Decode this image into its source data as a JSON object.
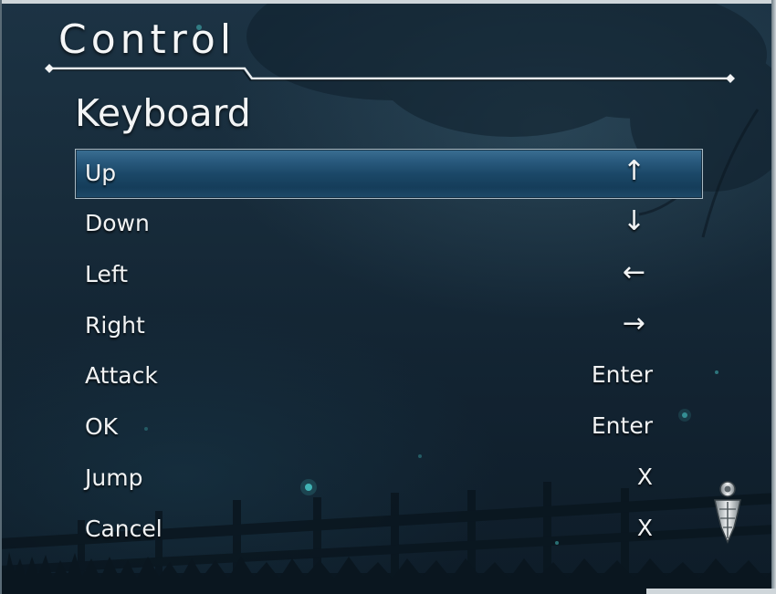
{
  "menu": {
    "title": "Control",
    "section": "Keyboard"
  },
  "bindings": [
    {
      "action": "Up",
      "key": "↑",
      "selected": true
    },
    {
      "action": "Down",
      "key": "↓",
      "selected": false
    },
    {
      "action": "Left",
      "key": "←",
      "selected": false
    },
    {
      "action": "Right",
      "key": "→",
      "selected": false
    },
    {
      "action": "Attack",
      "key": "Enter",
      "selected": false
    },
    {
      "action": "OK",
      "key": "Enter",
      "selected": false
    },
    {
      "action": "Jump",
      "key": "X",
      "selected": false
    },
    {
      "action": "Cancel",
      "key": "X",
      "selected": false
    }
  ],
  "icons": {
    "scroll_indicator": "scroll-down-icon"
  },
  "colors": {
    "highlight": "#1b4868",
    "text": "#f1f3f4",
    "background": "#172b3a"
  }
}
